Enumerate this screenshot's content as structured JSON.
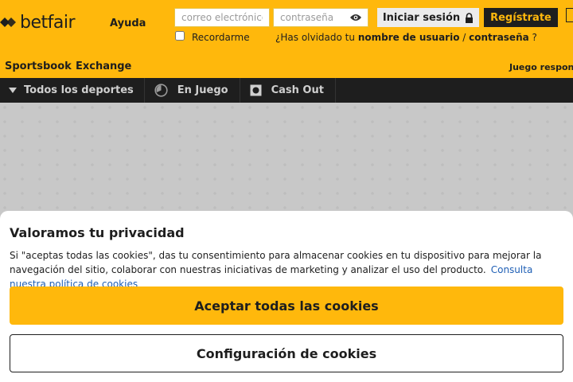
{
  "header": {
    "logo_text": "betfair",
    "help_label": "Ayuda",
    "email_placeholder": "correo electrónico",
    "password_placeholder": "contraseña",
    "login_label": "Iniciar sesión",
    "register_label": "Regístrate",
    "remember_label": "Recordarme",
    "forgot_prefix": "¿Has olvidado tu",
    "forgot_username": "nombre de usuario",
    "forgot_sep": "/",
    "forgot_password": "contraseña",
    "forgot_suffix": "?",
    "nav": [
      "Sportsbook",
      "Exchange"
    ],
    "responsible": "Juego responsable"
  },
  "sportbar": {
    "items": [
      "Todos los deportes",
      "En Juego",
      "Cash Out"
    ]
  },
  "cookie": {
    "title": "Valoramos tu privacidad",
    "text": "Si \"aceptas todas las cookies\", das tu consentimiento para almacenar cookies en tu dispositivo para mejorar la navegación del sitio, colaborar con nuestras iniciativas de marketing y analizar el uso del producto.",
    "link": "Consulta nuestra política de cookies",
    "accept_label": "Aceptar todas las cookies",
    "config_label": "Configuración de cookies"
  },
  "colors": {
    "brand_yellow": "#ffb80c",
    "dark": "#1e1e1e",
    "link_blue": "#1f5fb5"
  }
}
